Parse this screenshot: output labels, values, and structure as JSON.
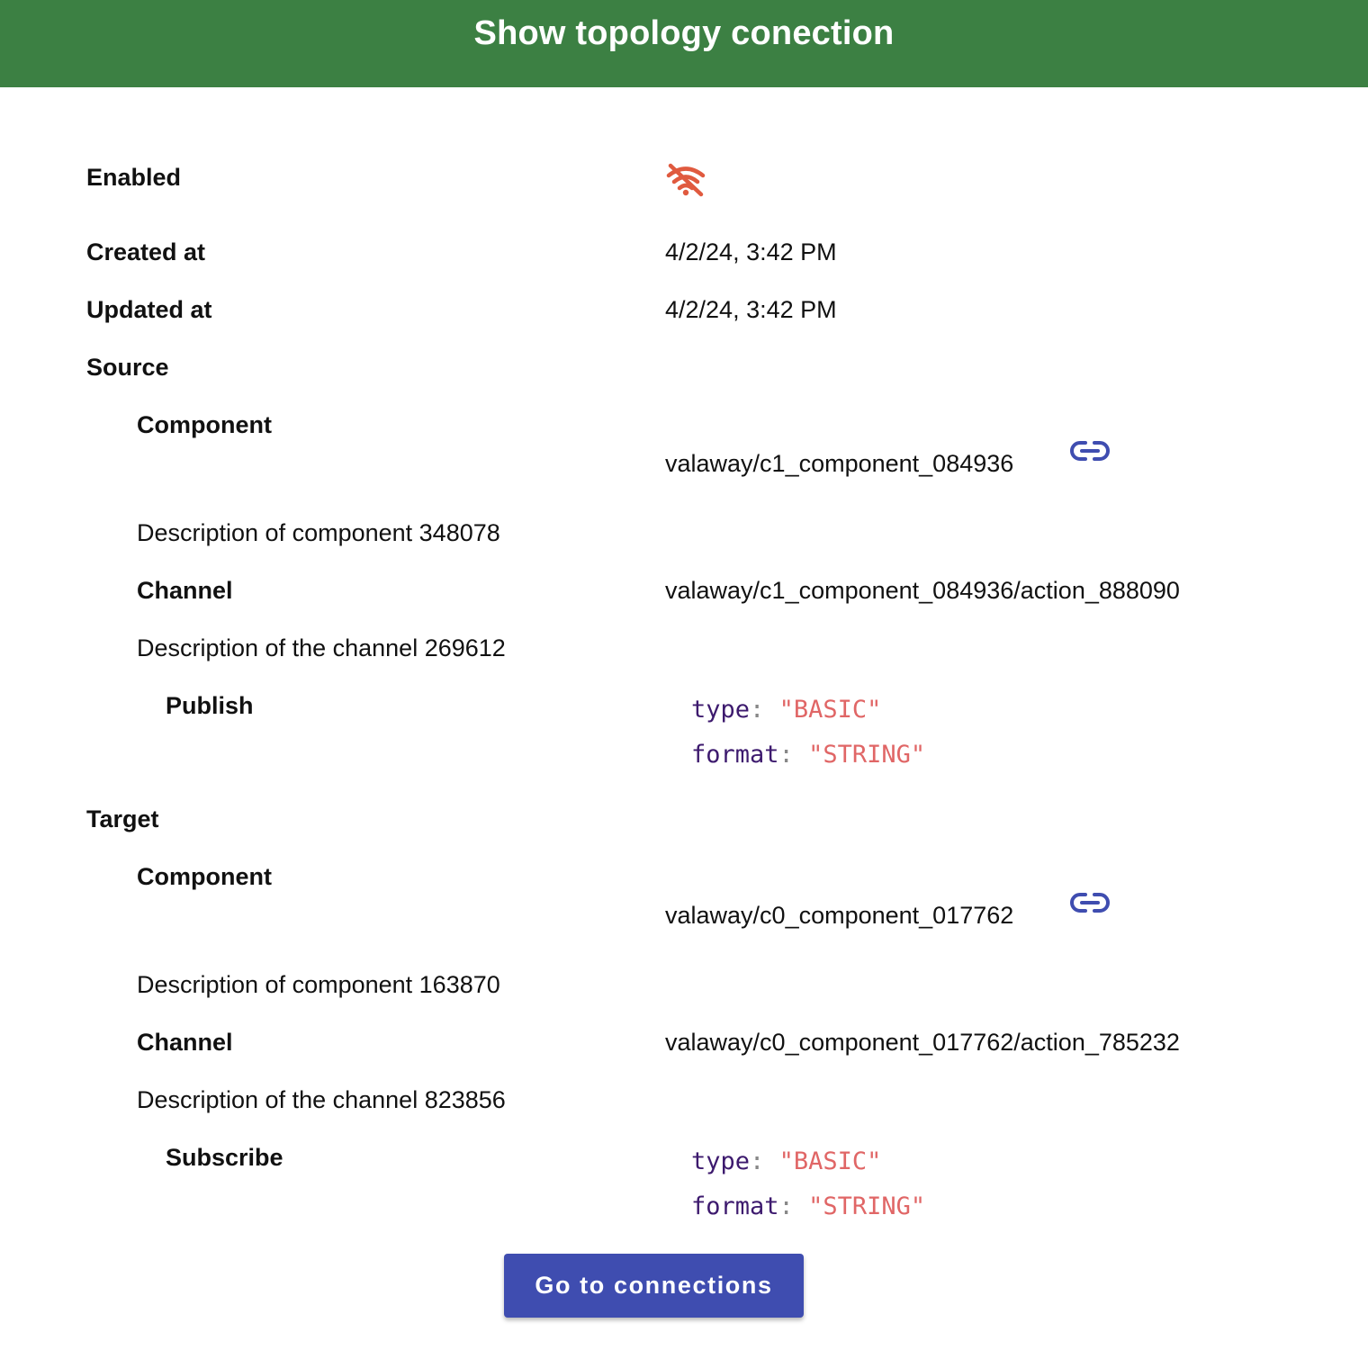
{
  "header": {
    "title": "Show topology conection"
  },
  "details": {
    "enabled_label": "Enabled",
    "enabled_icon": "wifi-off-icon",
    "enabled_icon_color": "#e05a3f",
    "created_label": "Created at",
    "created_value": "4/2/24, 3:42 PM",
    "updated_label": "Updated at",
    "updated_value": "4/2/24, 3:42 PM"
  },
  "source": {
    "heading": "Source",
    "component_label": "Component",
    "component_value": "valaway/c1_component_084936",
    "component_description": "Description of component 348078",
    "channel_label": "Channel",
    "channel_value": "valaway/c1_component_084936/action_888090",
    "channel_description": "Description of the channel 269612",
    "operation_label": "Publish",
    "operation": {
      "type_key": "type",
      "type_value": "\"BASIC\"",
      "format_key": "format",
      "format_value": "\"STRING\""
    }
  },
  "target": {
    "heading": "Target",
    "component_label": "Component",
    "component_value": "valaway/c0_component_017762",
    "component_description": "Description of component 163870",
    "channel_label": "Channel",
    "channel_value": "valaway/c0_component_017762/action_785232",
    "channel_description": "Description of the channel 823856",
    "operation_label": "Subscribe",
    "operation": {
      "type_key": "type",
      "type_value": "\"BASIC\"",
      "format_key": "format",
      "format_value": "\"STRING\""
    }
  },
  "actions": {
    "go_to_connections": "Go to connections"
  },
  "colors": {
    "header": "#3c8043",
    "button": "#3f4db0",
    "link_icon": "#3f4db0",
    "code_key": "#3d1a6e",
    "code_string": "#e06666"
  }
}
